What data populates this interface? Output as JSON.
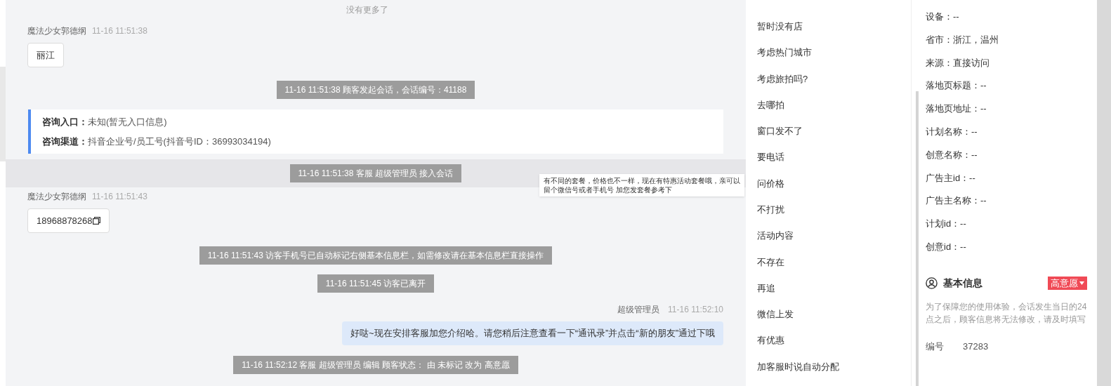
{
  "chat": {
    "no_more": "没有更多了",
    "messages": [
      {
        "kind": "visitor",
        "name": "魔法少女郭德纲",
        "time": "11-16 11:51:38",
        "text": "丽江",
        "copyable": false
      },
      {
        "kind": "system",
        "text": "11-16 11:51:38 顾客发起会话，会话编号：41188",
        "highlighted": false
      },
      {
        "kind": "entry_card",
        "rows": [
          {
            "label": "咨询入口：",
            "value": "未知(暂无入口信息)"
          },
          {
            "label": "咨询渠道：",
            "value": "抖音企业号/员工号(抖音号ID：36993034194)"
          }
        ]
      },
      {
        "kind": "system",
        "text": "11-16 11:51:38 客服 超级管理员 接入会话",
        "highlighted": true
      },
      {
        "kind": "visitor",
        "name": "魔法少女郭德纲",
        "time": "11-16 11:51:43",
        "text": "18968878268",
        "copyable": true
      },
      {
        "kind": "system",
        "text": "11-16 11:51:43 访客手机号已自动标记右侧基本信息栏，如需修改请在基本信息栏直接操作",
        "highlighted": false
      },
      {
        "kind": "system",
        "text": "11-16 11:51:45 访客已离开",
        "highlighted": false
      },
      {
        "kind": "agent",
        "name": "超级管理员",
        "time": "11-16 11:52:10",
        "text": "好哒~现在安排客服加您介绍哈。请您稍后注意查看一下“通讯录”并点击“新的朋友”通过下哦"
      },
      {
        "kind": "system",
        "text": "11-16 11:52:12 客服 超级管理员 编辑 顾客状态： 由 未标记 改为 高意愿",
        "highlighted": false
      }
    ]
  },
  "tooltip": {
    "text": "有不同的套餐，价格也不一样，现在有特惠活动套餐哦，亲可以留个微信号或者手机号 加您发套餐参考下"
  },
  "quick_replies": [
    "暂时没有店",
    "考虑热门城市",
    "考虑旅拍吗?",
    "去哪拍",
    "窗口发不了",
    "要电话",
    "问价格",
    "不打扰",
    "活动内容",
    "不存在",
    "再追",
    "微信上发",
    "有优惠",
    "加客服时说自动分配"
  ],
  "info": {
    "fields": [
      "设备：--",
      "省市：浙江，温州",
      "来源：直接访问",
      "落地页标题：--",
      "落地页地址：--",
      "计划名称：--",
      "创意名称：--",
      "广告主id：--",
      "广告主名称：--",
      "计划id：--",
      "创意id：--"
    ],
    "basic": {
      "title": "基本信息",
      "tag": "高意愿",
      "note": "为了保障您的使用体验，会话发生当日的24点之后，顾客信息将无法修改，请及时填写",
      "fields": [
        {
          "label": "编号",
          "value": "37283"
        }
      ]
    }
  }
}
